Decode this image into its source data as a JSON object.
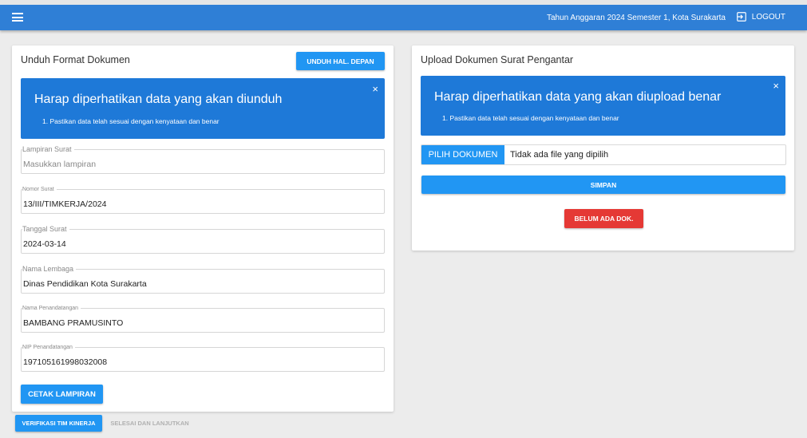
{
  "topbar": {
    "info": "Tahun Anggaran 2024 Semester 1, Kota Surakarta",
    "logout_label": "LOGOUT",
    "menu_icon": "hamburger-menu-icon",
    "logout_icon": "logout-icon",
    "color": "#2f7fd6"
  },
  "left": {
    "title": "Unduh Format Dokumen",
    "unduh_button": "UNDUH HAL. DEPAN",
    "alert": {
      "title": "Harap diperhatikan data yang akan diunduh",
      "item": "1. Pastikan data telah sesuai dengan kenyataan dan benar",
      "close": "×"
    },
    "fields": [
      {
        "label": "Lampiran Surat",
        "value": "",
        "placeholder": "Masukkan lampiran"
      },
      {
        "label": "Nomor Surat",
        "value": "13/III/TIMKERJA/2024",
        "placeholder": ""
      },
      {
        "label": "Tanggal Surat",
        "value": "2024-03-14",
        "placeholder": ""
      },
      {
        "label": "Nama Lembaga",
        "value": "Dinas Pendidikan Kota Surakarta",
        "placeholder": ""
      },
      {
        "label": "Nama Penandatangan",
        "value": "BAMBANG PRAMUSINTO",
        "placeholder": ""
      },
      {
        "label": "NIP Penandatangan",
        "value": "197105161998032008",
        "placeholder": ""
      }
    ],
    "cetak_button": "CETAK LAMPIRAN"
  },
  "right": {
    "title": "Upload Dokumen Surat Pengantar",
    "alert": {
      "title": "Harap diperhatikan data yang akan diupload benar",
      "item": "1. Pastikan data telah sesuai dengan kenyataan dan benar",
      "close": "×"
    },
    "file_button": "PILIH DOKUMEN",
    "file_status": "Tidak ada file yang dipilih",
    "simpan_button": "SIMPAN",
    "belum_button": "BELUM ADA DOK."
  },
  "bottom": {
    "verifikasi_button": "VERIFIKASI TIM KINERJA",
    "selesai_button": "SELESAI DAN LANJUTKAN"
  },
  "colors": {
    "primary": "#2196f3",
    "alert": "#1e79d8",
    "danger": "#e53935",
    "background": "#ececec"
  }
}
